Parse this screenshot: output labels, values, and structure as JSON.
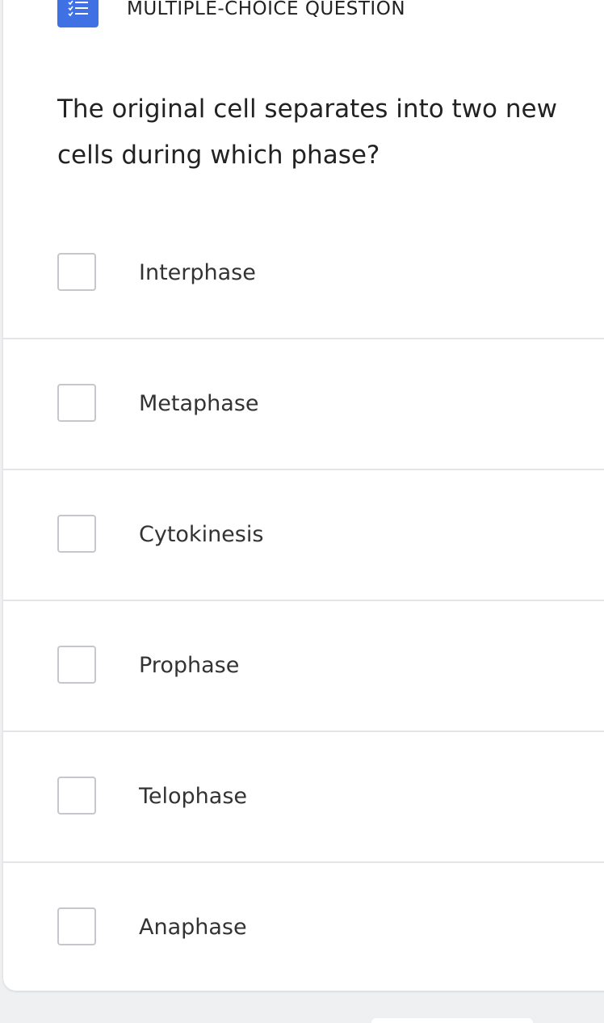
{
  "question_type": {
    "icon": "list-check-icon",
    "label": "MULTIPLE-CHOICE QUESTION",
    "color": "#3f71e4"
  },
  "question": {
    "text": "The original cell separates into two new cells during which phase?"
  },
  "options": [
    {
      "label": "Interphase",
      "checked": false
    },
    {
      "label": "Metaphase",
      "checked": false
    },
    {
      "label": "Cytokinesis",
      "checked": false
    },
    {
      "label": "Prophase",
      "checked": false
    },
    {
      "label": "Telophase",
      "checked": false
    },
    {
      "label": "Anaphase",
      "checked": false
    }
  ]
}
